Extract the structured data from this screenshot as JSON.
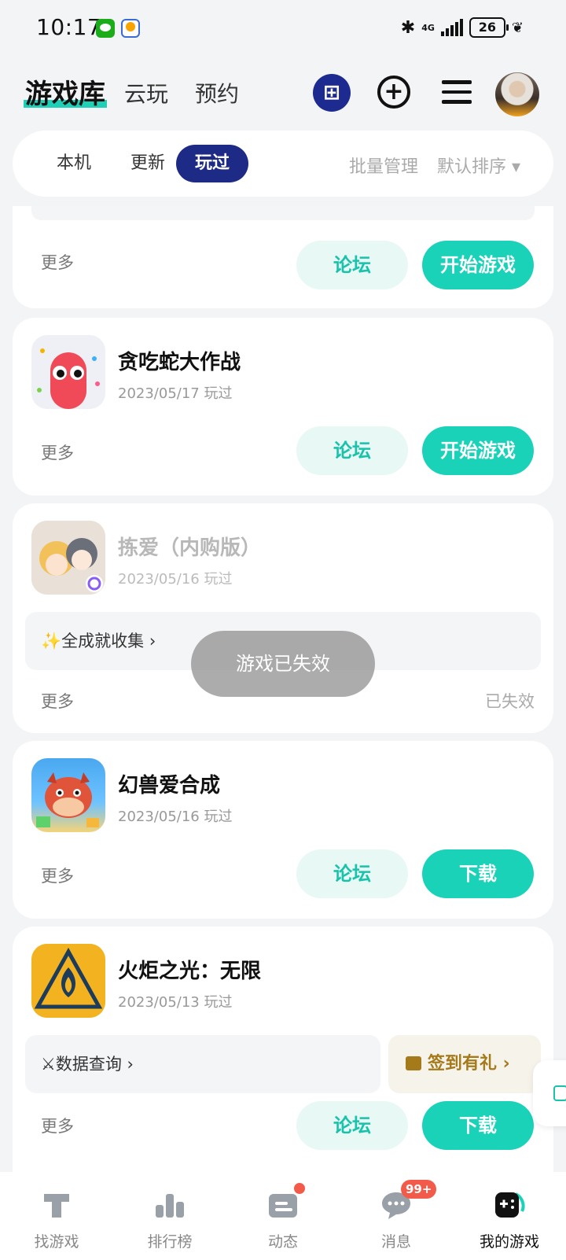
{
  "status_bar": {
    "time": "10:17",
    "network": "4G",
    "battery": "26"
  },
  "header": {
    "tabs": [
      {
        "label": "游戏库"
      },
      {
        "label": "云玩"
      },
      {
        "label": "预约"
      }
    ],
    "gift_glyph": "⊞"
  },
  "filter": {
    "tabs": [
      {
        "label": "本机"
      },
      {
        "label": "更新"
      },
      {
        "label": "玩过"
      }
    ],
    "batch_manage": "批量管理",
    "sort": "默认排序 ▾"
  },
  "cards": [
    {
      "more": "更多",
      "forum": "论坛",
      "action": "开始游戏"
    },
    {
      "title": "贪吃蛇大作战",
      "date": "2023/05/17 玩过",
      "more": "更多",
      "forum": "论坛",
      "action": "开始游戏"
    },
    {
      "title": "拣爱（内购版）",
      "date": "2023/05/16 玩过",
      "feature": "✨全成就收集 ›",
      "more": "更多",
      "status": "已失效"
    },
    {
      "title": "幻兽爱合成",
      "date": "2023/05/16 玩过",
      "more": "更多",
      "forum": "论坛",
      "action": "下载"
    },
    {
      "title": "火炬之光：无限",
      "date": "2023/05/13 玩过",
      "feature": "⚔数据查询 ›",
      "signin": "签到有礼 ›",
      "more": "更多",
      "forum": "论坛",
      "action": "下载"
    }
  ],
  "toast": "游戏已失效",
  "bottom_nav": {
    "items": [
      {
        "label": "找游戏"
      },
      {
        "label": "排行榜"
      },
      {
        "label": "动态"
      },
      {
        "label": "消息",
        "badge": "99+"
      },
      {
        "label": "我的游戏"
      }
    ]
  },
  "colors": {
    "accent": "#19d2b8",
    "brand_navy": "#1e2b86",
    "badge_red": "#f25b4a"
  }
}
